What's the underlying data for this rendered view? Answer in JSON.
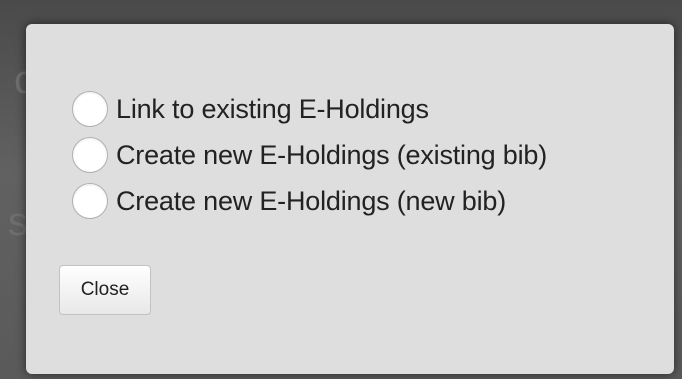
{
  "dialog": {
    "options": [
      {
        "label": "Link to existing E-Holdings",
        "selected": false
      },
      {
        "label": "Create new E-Holdings (existing bib)",
        "selected": false
      },
      {
        "label": "Create new E-Holdings (new bib)",
        "selected": false
      }
    ],
    "close_label": "Close"
  },
  "colors": {
    "backdrop": "#5b5b5b",
    "dialog_background": "#dedede",
    "text": "#222222"
  }
}
